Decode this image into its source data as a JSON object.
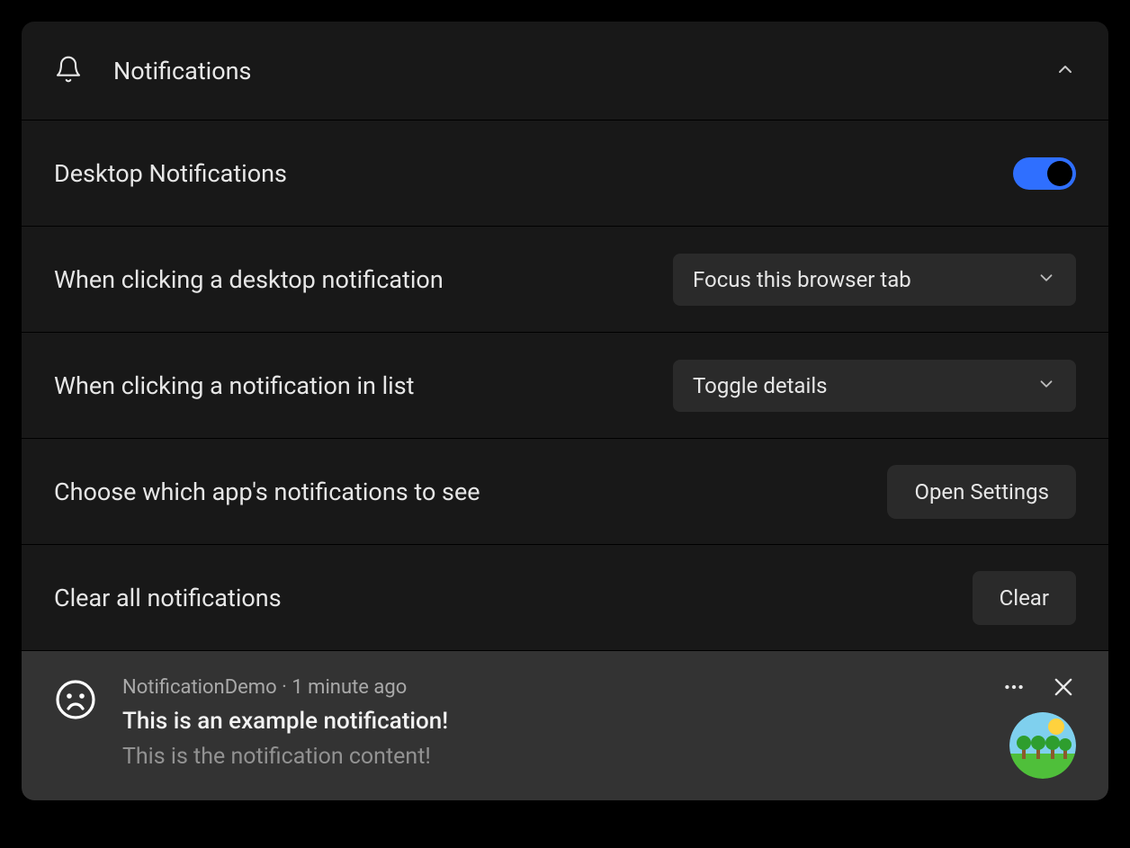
{
  "header": {
    "title": "Notifications"
  },
  "rows": {
    "desktop": {
      "label": "Desktop Notifications",
      "enabled": true
    },
    "clickDesktop": {
      "label": "When clicking a desktop notification",
      "value": "Focus this browser tab"
    },
    "clickList": {
      "label": "When clicking a notification in list",
      "value": "Toggle details"
    },
    "chooseApps": {
      "label": "Choose which app's notifications to see",
      "button": "Open Settings"
    },
    "clearAll": {
      "label": "Clear all notifications",
      "button": "Clear"
    }
  },
  "notification": {
    "app": "NotificationDemo",
    "separator": " · ",
    "time": "1 minute ago",
    "title": "This is an example notification!",
    "content": "This is the notification content!"
  },
  "icons": {
    "bell": "bell-icon",
    "chevronUp": "chevron-up-icon",
    "chevronDown": "chevron-down-icon",
    "sadFace": "sad-face-icon",
    "more": "more-icon",
    "close": "close-icon",
    "thumb": "landscape-thumb"
  },
  "colors": {
    "accent": "#2f6fff",
    "panel": "#181818",
    "row": "#181818",
    "card": "#333333",
    "control": "#2a2a2a"
  }
}
